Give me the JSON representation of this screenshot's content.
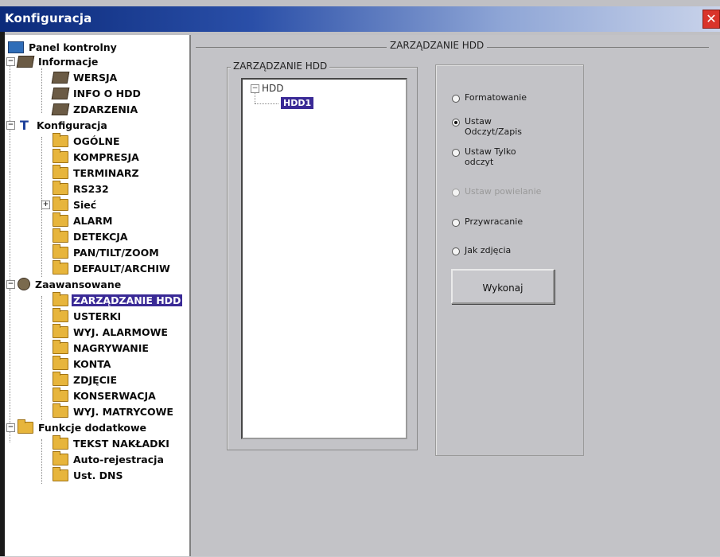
{
  "window": {
    "title": "Konfiguracja",
    "close_label": "✕"
  },
  "tree": {
    "root": "Panel kontrolny",
    "informacje": {
      "label": "Informacje",
      "items": [
        "WERSJA",
        "INFO O HDD",
        "ZDARZENIA"
      ]
    },
    "konfiguracja": {
      "label": "Konfiguracja",
      "items": [
        "OGÓLNE",
        "KOMPRESJA",
        "TERMINARZ",
        "RS232",
        "Sieć",
        "ALARM",
        "DETEKCJA",
        "PAN/TILT/ZOOM",
        "DEFAULT/ARCHIW"
      ]
    },
    "zaawansowane": {
      "label": "Zaawansowane",
      "items": [
        "ZARZĄDZANIE HDD",
        "USTERKI",
        "WYJ. ALARMOWE",
        "NAGRYWANIE",
        "KONTA",
        "ZDJĘCIE",
        "KONSERWACJA",
        "WYJ. MATRYCOWE"
      ]
    },
    "funkcje": {
      "label": "Funkcje dodatkowe",
      "items": [
        "TEKST NAKŁADKI",
        "Auto-rejestracja",
        "Ust. DNS"
      ]
    },
    "expander_collapsed": "+",
    "expander_expanded": "−"
  },
  "main": {
    "title": "ZARZĄDZANIE HDD",
    "group_title": "ZARZĄDZANIE HDD",
    "hdd_tree": {
      "root": "HDD",
      "child": "HDD1",
      "expander": "−"
    },
    "options": [
      {
        "line1": "Formatowanie",
        "line2": ""
      },
      {
        "line1": "Ustaw",
        "line2": "Odczyt/Zapis"
      },
      {
        "line1": "Ustaw Tylko",
        "line2": "odczyt"
      },
      {
        "line1": "Ustaw powielanie",
        "line2": ""
      },
      {
        "line1": "Przywracanie",
        "line2": ""
      },
      {
        "line1": "Jak zdjęcia",
        "line2": ""
      }
    ],
    "selected_option": "Ustaw Odczyt/Zapis",
    "execute_label": "Wykonaj"
  },
  "colors": {
    "selection": "#3a2a96",
    "titlebar": "#0b2a7a",
    "close": "#d9342b",
    "panel": "#c3c3c7"
  }
}
